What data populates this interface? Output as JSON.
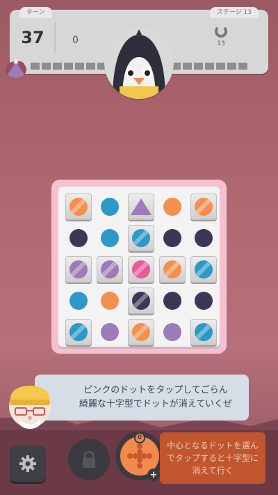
{
  "hud": {
    "turns_label": "ターン",
    "turns_value": "37",
    "score": "0",
    "stage_label": "ステージ 13",
    "target_count": "13",
    "star_icon": "star-icon",
    "triangle_icon": "triangle-icon"
  },
  "board": {
    "rows": [
      [
        {
          "shape": "dot",
          "color": "#f4904e",
          "block": true
        },
        {
          "shape": "dot",
          "color": "#2e98c9",
          "block": false
        },
        {
          "shape": "triangle",
          "color": "#9d7bb8",
          "block": true
        },
        {
          "shape": "dot",
          "color": "#f4904e",
          "block": false
        },
        {
          "shape": "dot",
          "color": "#f4904e",
          "block": true
        }
      ],
      [
        {
          "shape": "dot",
          "color": "#3f3557",
          "block": false
        },
        {
          "shape": "dot",
          "color": "#2e98c9",
          "block": false
        },
        {
          "shape": "dot",
          "color": "#2e98c9",
          "block": true
        },
        {
          "shape": "dot",
          "color": "#3f3557",
          "block": false
        },
        {
          "shape": "dot",
          "color": "#3f3557",
          "block": false
        }
      ],
      [
        {
          "shape": "dot",
          "color": "#9d7bb8",
          "block": true
        },
        {
          "shape": "dot",
          "color": "#9d7bb8",
          "block": true
        },
        {
          "shape": "dot",
          "color": "#e85a9a",
          "block": true
        },
        {
          "shape": "dot",
          "color": "#f4904e",
          "block": true
        },
        {
          "shape": "dot",
          "color": "#2e98c9",
          "block": true
        }
      ],
      [
        {
          "shape": "dot",
          "color": "#2e98c9",
          "block": false
        },
        {
          "shape": "dot",
          "color": "#f4904e",
          "block": false
        },
        {
          "shape": "dot",
          "color": "#3f3557",
          "block": true
        },
        {
          "shape": "dot",
          "color": "#3f3557",
          "block": false
        },
        {
          "shape": "dot",
          "color": "#3f3557",
          "block": false
        }
      ],
      [
        {
          "shape": "dot",
          "color": "#2e98c9",
          "block": true
        },
        {
          "shape": "dot",
          "color": "#9d7bb8",
          "block": false
        },
        {
          "shape": "dot",
          "color": "#f4904e",
          "block": true
        },
        {
          "shape": "dot",
          "color": "#9d7bb8",
          "block": false
        },
        {
          "shape": "dot",
          "color": "#2e98c9",
          "block": true
        }
      ]
    ]
  },
  "hint": {
    "line1": "ピンクのドットをタップしてごらん",
    "line2": "綺麗な十字型でドットが消えていくぜ"
  },
  "toolbar": {
    "settings_icon": "gear-icon",
    "lock_icon": "lock-icon",
    "cross_item_count": "0",
    "plus_label": "+",
    "cross_desc": "中心となるドットを選んでタップすると十字型に消えて行く"
  },
  "colors": {
    "orange": "#f4904e",
    "blue": "#2e98c9",
    "navy": "#3f3557",
    "purple": "#9d7bb8",
    "pink": "#e85a9a",
    "board_frame": "#f5c0d0"
  }
}
